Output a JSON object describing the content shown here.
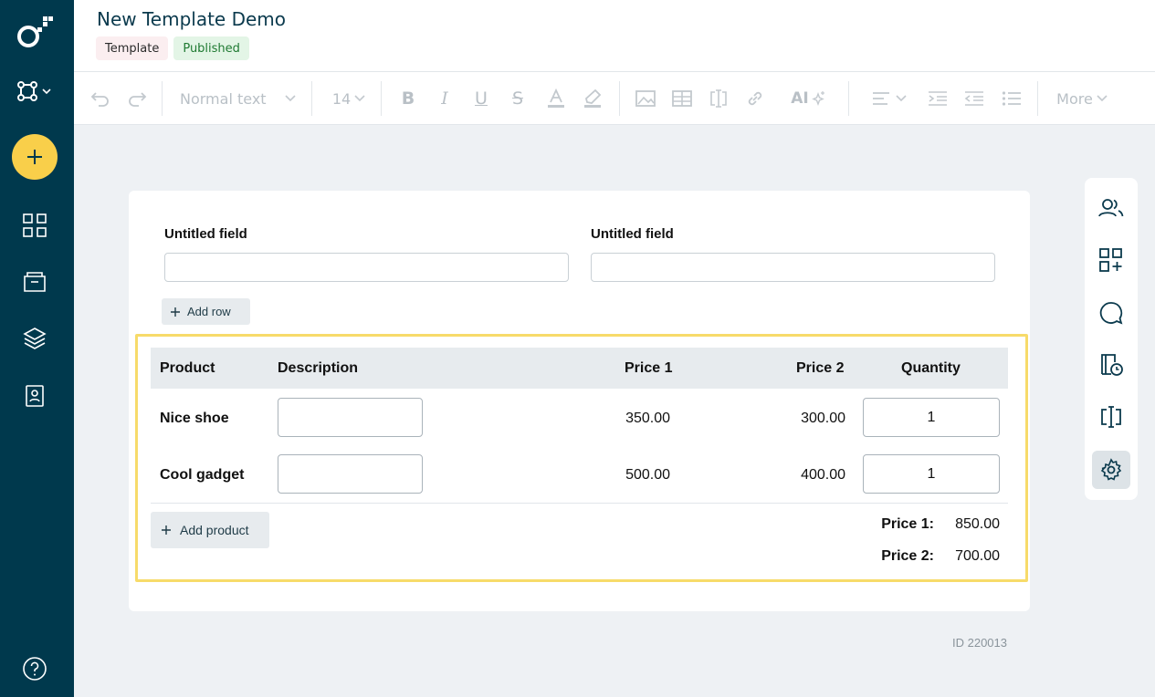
{
  "header": {
    "title": "New Template Demo",
    "badges": [
      "Template",
      "Published"
    ]
  },
  "toolbar": {
    "text_style": "Normal text",
    "font_size": "14",
    "ai_label": "AI",
    "more_label": "More"
  },
  "form": {
    "fields": [
      {
        "label": "Untitled field",
        "value": ""
      },
      {
        "label": "Untitled field",
        "value": ""
      }
    ],
    "add_row_label": "Add row"
  },
  "products": {
    "columns": [
      "Product",
      "Description",
      "Price 1",
      "Price 2",
      "Quantity"
    ],
    "rows": [
      {
        "name": "Nice shoe",
        "description": "",
        "price1": "350.00",
        "price2": "300.00",
        "quantity": "1"
      },
      {
        "name": "Cool gadget",
        "description": "",
        "price1": "500.00",
        "price2": "400.00",
        "quantity": "1"
      }
    ],
    "add_product_label": "Add product",
    "totals": [
      {
        "label": "Price 1:",
        "value": "850.00"
      },
      {
        "label": "Price 2:",
        "value": "700.00"
      }
    ]
  },
  "doc_id": "ID 220013",
  "colors": {
    "nav_bg": "#00394d",
    "accent_yellow": "#f9cf4a",
    "highlight_border": "#f7db6a",
    "published_green": "#1f7a32"
  },
  "icons": {
    "nav": [
      "logo-icon",
      "workspace-icon",
      "plus-icon",
      "grid-icon",
      "folder-icon",
      "layers-icon",
      "contact-icon",
      "help-icon"
    ],
    "side": [
      "people-icon",
      "add-widget-icon",
      "comment-icon",
      "history-icon",
      "text-cursor-icon",
      "settings-icon"
    ]
  }
}
